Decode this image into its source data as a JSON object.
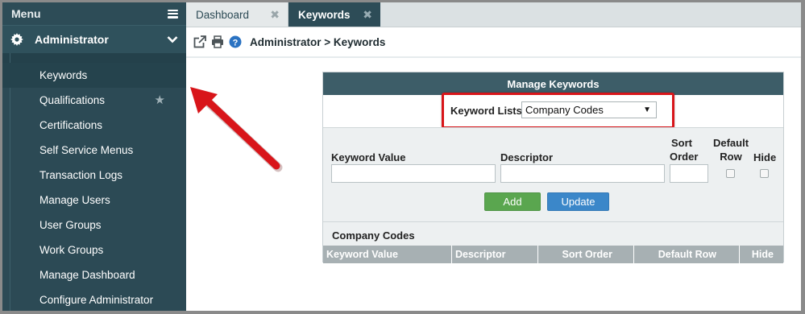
{
  "sidebar": {
    "menu_label": "Menu",
    "section_label": "Administrator",
    "items": [
      {
        "label": "Keywords",
        "active": true
      },
      {
        "label": "Qualifications",
        "starred": true
      },
      {
        "label": "Certifications"
      },
      {
        "label": "Self Service Menus"
      },
      {
        "label": "Transaction Logs"
      },
      {
        "label": "Manage Users"
      },
      {
        "label": "User Groups"
      },
      {
        "label": "Work Groups"
      },
      {
        "label": "Manage Dashboard"
      },
      {
        "label": "Configure Administrator"
      }
    ],
    "star_glyph": "★"
  },
  "tabs": [
    {
      "label": "Dashboard",
      "close": "✖"
    },
    {
      "label": "Keywords",
      "close": "✖"
    }
  ],
  "toolbar": {
    "icons": [
      "external-link-icon",
      "print-icon",
      "help-icon"
    ],
    "breadcrumb": "Administrator > Keywords"
  },
  "panel": {
    "title": "Manage Keywords",
    "keyword_lists_label": "Keyword Lists",
    "keyword_lists_value": "Company Codes",
    "form": {
      "keyword_value_label": "Keyword Value",
      "descriptor_label": "Descriptor",
      "sort_order_label_line1": "Sort",
      "sort_order_label_line2": "Order",
      "default_row_label_line1": "Default",
      "default_row_label_line2": "Row",
      "hide_label": "Hide",
      "add_button": "Add",
      "update_button": "Update"
    },
    "list": {
      "title": "Company Codes",
      "columns": [
        "Keyword Value",
        "Descriptor",
        "Sort Order",
        "Default Row",
        "Hide"
      ]
    }
  },
  "colors": {
    "sidebar_bg": "#2b4a55",
    "panel_header": "#3d5d68",
    "add_green": "#5aa64f",
    "update_blue": "#3b87c9",
    "highlight_red": "#d8151a",
    "arrow_red": "#d8151a"
  }
}
